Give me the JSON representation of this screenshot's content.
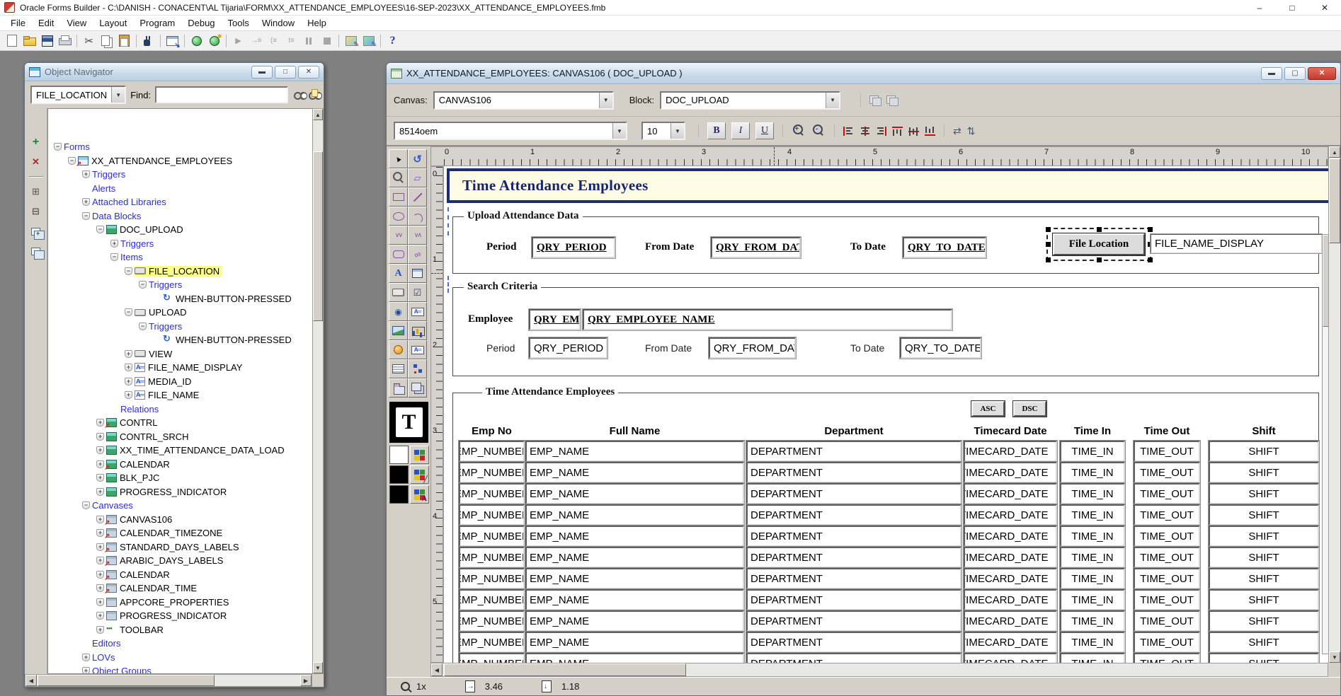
{
  "app": {
    "title": "Oracle Forms Builder - C:\\DANISH - CONACENT\\AL Tijaria\\FORM\\XX_ATTENDANCE_EMPLOYEES\\16-SEP-2023\\XX_ATTENDANCE_EMPLOYEES.fmb"
  },
  "menu": {
    "items": [
      "File",
      "Edit",
      "View",
      "Layout",
      "Program",
      "Debug",
      "Tools",
      "Window",
      "Help"
    ]
  },
  "main_toolbar": {
    "icons": [
      "new-form",
      "open",
      "save",
      "print",
      "cut",
      "copy",
      "paste",
      "connect",
      "run-form",
      "compile-file",
      "compile-all",
      "debug-run",
      "step-into",
      "step-over",
      "step-out",
      "pause",
      "stop",
      "layout-wizard",
      "data-block-wizard",
      "help"
    ]
  },
  "colors": {
    "accent_navy": "#1c2d70",
    "banner_bg": "#fffce6",
    "highlight_yellow": "#ffff8c",
    "mdi_background": "#808080",
    "close_button_red": "#c23a2e"
  },
  "object_navigator": {
    "title": "Object Navigator",
    "type_selector_value": "FILE_LOCATION",
    "find_label": "Find:",
    "find_value": "",
    "side_toolbar": [
      "create",
      "delete",
      "expand",
      "collapse",
      "expand-all",
      "collapse-all"
    ],
    "tree": [
      {
        "label": "Forms",
        "level": 0,
        "type": "cat",
        "marker": "minus"
      },
      {
        "label": "XX_ATTENDANCE_EMPLOYEES",
        "level": 1,
        "type": "obj",
        "icon": "form",
        "marker": "minus"
      },
      {
        "label": "Triggers",
        "level": 2,
        "type": "cat",
        "marker": "plus"
      },
      {
        "label": "Alerts",
        "level": 2,
        "type": "cat",
        "marker": "none"
      },
      {
        "label": "Attached Libraries",
        "level": 2,
        "type": "cat",
        "marker": "plus"
      },
      {
        "label": "Data Blocks",
        "level": 2,
        "type": "cat",
        "marker": "minus"
      },
      {
        "label": "DOC_UPLOAD",
        "level": 3,
        "type": "obj",
        "icon": "block",
        "marker": "minus"
      },
      {
        "label": "Triggers",
        "level": 4,
        "type": "cat",
        "marker": "plus"
      },
      {
        "label": "Items",
        "level": 4,
        "type": "cat",
        "marker": "minus"
      },
      {
        "label": "FILE_LOCATION",
        "level": 5,
        "type": "obj",
        "icon": "button",
        "marker": "minus",
        "highlight": true
      },
      {
        "label": "Triggers",
        "level": 6,
        "type": "cat",
        "marker": "minus"
      },
      {
        "label": "WHEN-BUTTON-PRESSED",
        "level": 7,
        "type": "obj",
        "icon": "trigger",
        "marker": "none"
      },
      {
        "label": "UPLOAD",
        "level": 5,
        "type": "obj",
        "icon": "button",
        "marker": "minus"
      },
      {
        "label": "Triggers",
        "level": 6,
        "type": "cat",
        "marker": "minus"
      },
      {
        "label": "WHEN-BUTTON-PRESSED",
        "level": 7,
        "type": "obj",
        "icon": "trigger",
        "marker": "none"
      },
      {
        "label": "VIEW",
        "level": 5,
        "type": "obj",
        "icon": "button",
        "marker": "plus"
      },
      {
        "label": "FILE_NAME_DISPLAY",
        "level": 5,
        "type": "obj",
        "icon": "item",
        "marker": "plus"
      },
      {
        "label": "MEDIA_ID",
        "level": 5,
        "type": "obj",
        "icon": "item",
        "marker": "plus"
      },
      {
        "label": "FILE_NAME",
        "level": 5,
        "type": "obj",
        "icon": "item",
        "marker": "plus"
      },
      {
        "label": "Relations",
        "level": 4,
        "type": "cat",
        "marker": "none"
      },
      {
        "label": "CONTRL",
        "level": 3,
        "type": "obj",
        "icon": "block-arrow",
        "marker": "plus"
      },
      {
        "label": "CONTRL_SRCH",
        "level": 3,
        "type": "obj",
        "icon": "block",
        "marker": "plus"
      },
      {
        "label": "XX_TIME_ATTENDANCE_DATA_LOAD",
        "level": 3,
        "type": "obj",
        "icon": "block",
        "marker": "plus"
      },
      {
        "label": "CALENDAR",
        "level": 3,
        "type": "obj",
        "icon": "block-arrow",
        "marker": "plus"
      },
      {
        "label": "BLK_PJC",
        "level": 3,
        "type": "obj",
        "icon": "block",
        "marker": "plus"
      },
      {
        "label": "PROGRESS_INDICATOR",
        "level": 3,
        "type": "obj",
        "icon": "block",
        "marker": "plus"
      },
      {
        "label": "Canvases",
        "level": 2,
        "type": "cat",
        "marker": "minus"
      },
      {
        "label": "CANVAS106",
        "level": 3,
        "type": "obj",
        "icon": "canvas-arrow",
        "marker": "plus"
      },
      {
        "label": "CALENDAR_TIMEZONE",
        "level": 3,
        "type": "obj",
        "icon": "canvas-arrow",
        "marker": "plus"
      },
      {
        "label": "STANDARD_DAYS_LABELS",
        "level": 3,
        "type": "obj",
        "icon": "canvas-arrow",
        "marker": "plus"
      },
      {
        "label": "ARABIC_DAYS_LABELS",
        "level": 3,
        "type": "obj",
        "icon": "canvas-arrow",
        "marker": "plus"
      },
      {
        "label": "CALENDAR",
        "level": 3,
        "type": "obj",
        "icon": "canvas-arrow",
        "marker": "plus"
      },
      {
        "label": "CALENDAR_TIME",
        "level": 3,
        "type": "obj",
        "icon": "canvas-arrow",
        "marker": "plus"
      },
      {
        "label": "APPCORE_PROPERTIES",
        "level": 3,
        "type": "obj",
        "icon": "canvas-plain",
        "marker": "plus"
      },
      {
        "label": "PROGRESS_INDICATOR",
        "level": 3,
        "type": "obj",
        "icon": "canvas-plain",
        "marker": "plus"
      },
      {
        "label": "TOOLBAR",
        "level": 3,
        "type": "obj",
        "icon": "toolbar-ic",
        "marker": "plus"
      },
      {
        "label": "Editors",
        "level": 2,
        "type": "cat",
        "marker": "none"
      },
      {
        "label": "LOVs",
        "level": 2,
        "type": "cat",
        "marker": "plus"
      },
      {
        "label": "Object Groups",
        "level": 2,
        "type": "cat",
        "marker": "plus"
      }
    ]
  },
  "layout_editor": {
    "title": "XX_ATTENDANCE_EMPLOYEES: CANVAS106 ( DOC_UPLOAD )",
    "canvas_label": "Canvas:",
    "canvas_value": "CANVAS106",
    "block_label": "Block:",
    "block_value": "DOC_UPLOAD",
    "font_toolbar": {
      "font_name": "8514oem",
      "font_size": "10",
      "bold": "B",
      "italic": "I",
      "underline": "U"
    },
    "tool_palette": [
      "select",
      "rotate",
      "magnify",
      "reshape",
      "rect",
      "line",
      "ellipse",
      "arc",
      "polygon",
      "polyline",
      "rounded",
      "freehand",
      "text",
      "frame",
      "button",
      "check",
      "radio",
      "titem",
      "image",
      "chart",
      "sound",
      "ditem",
      "list",
      "tree",
      "tab",
      "stacked"
    ],
    "font_indicator": "T",
    "ruler_h": [
      "0",
      "1",
      "2",
      "3",
      "4",
      "5",
      "6",
      "7",
      "8",
      "9",
      "10"
    ],
    "ruler_v": [
      "0",
      "1",
      "2",
      "3",
      "4",
      "5"
    ],
    "status_bar": {
      "zoom": "1x",
      "pos_x": "3.46",
      "pos_y": "1.18"
    },
    "canvas": {
      "banner_title": "Time Attendance Employees",
      "upload": {
        "legend": "Upload Attendance Data",
        "period_label": "Period",
        "period_value": "QRY_PERIOD",
        "from_label": "From Date",
        "from_value": "QRY_FROM_DATE",
        "to_label": "To Date",
        "to_value": "QRY_TO_DATE",
        "file_location_button": "File Location",
        "file_name_display_value": "FILE_NAME_DISPLAY"
      },
      "search": {
        "legend": "Search Criteria",
        "employee_label": "Employee",
        "employee_id_value": "QRY_EMP",
        "employee_name_value": "QRY_EMPLOYEE_NAME",
        "period_label": "Period",
        "period_value": "QRY_PERIOD",
        "from_label": "From Date",
        "from_value": "QRY_FROM_DATE",
        "to_label": "To Date",
        "to_value": "QRY_TO_DATE"
      },
      "table": {
        "legend": "Time Attendance Employees",
        "asc_button": "ASC",
        "dsc_button": "DSC",
        "columns": [
          "Emp No",
          "Full Name",
          "Department",
          "Timecard Date",
          "Time In",
          "Time Out",
          "Shift"
        ],
        "row_values": [
          "EMP_NUMBER",
          "EMP_NAME",
          "DEPARTMENT",
          "TIMECARD_DATE",
          "TIME_IN",
          "TIME_OUT",
          "SHIFT"
        ],
        "visible_rows": 11
      }
    }
  }
}
